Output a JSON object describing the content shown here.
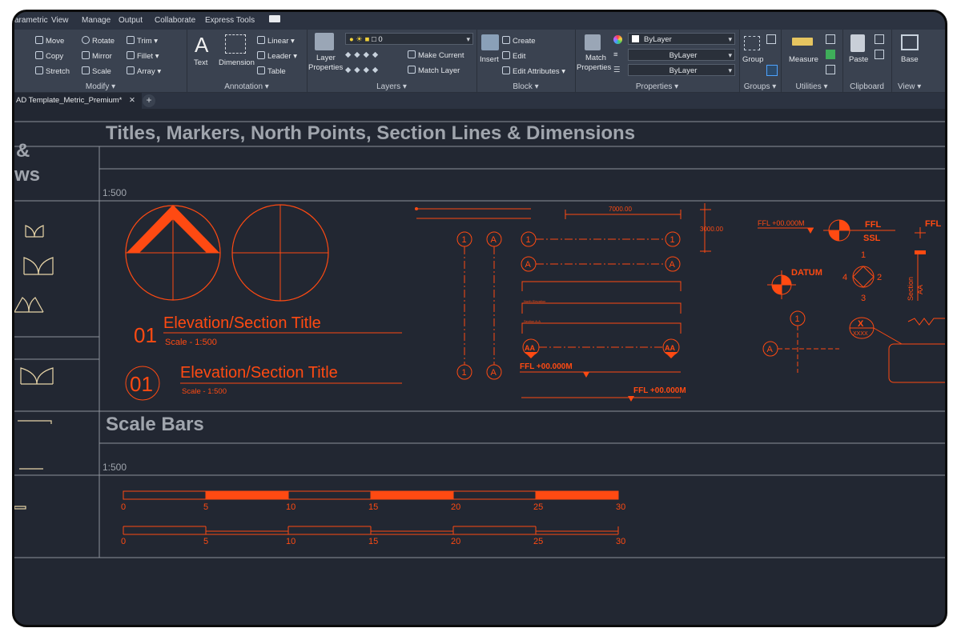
{
  "menu": {
    "items": [
      "arametric",
      "View",
      "Manage",
      "Output",
      "Collaborate",
      "Express Tools"
    ]
  },
  "ribbon": {
    "modify": {
      "title": "Modify ▾",
      "move": "Move",
      "rotate": "Rotate",
      "trim": "Trim",
      "copy": "Copy",
      "mirror": "Mirror",
      "fillet": "Fillet",
      "stretch": "Stretch",
      "scale": "Scale",
      "array": "Array"
    },
    "annotation": {
      "title": "Annotation ▾",
      "text": "Text",
      "dimension": "Dimension",
      "linear": "Linear",
      "leader": "Leader",
      "table": "Table"
    },
    "layers": {
      "title": "Layers ▾",
      "layer_properties_1": "Layer",
      "layer_properties_2": "Properties",
      "current_layer": "0",
      "make_current": "Make Current",
      "match_layer": "Match Layer"
    },
    "block": {
      "title": "Block ▾",
      "insert": "Insert",
      "create": "Create",
      "edit": "Edit",
      "edit_attributes": "Edit Attributes"
    },
    "properties": {
      "title": "Properties ▾",
      "match_1": "Match",
      "match_2": "Properties",
      "color": "ByLayer",
      "linetype": "ByLayer",
      "lineweight": "ByLayer"
    },
    "groups": {
      "title": "Groups ▾",
      "group": "Group"
    },
    "utilities": {
      "title": "Utilities ▾",
      "measure": "Measure"
    },
    "clipboard": {
      "title": "Clipboard",
      "paste": "Paste"
    },
    "view": {
      "title": "View ▾",
      "base": "Base"
    }
  },
  "tab": {
    "label": "AD Template_Metric_Premium*",
    "close": "✕",
    "new": "+"
  },
  "drawing": {
    "left_heading_1": "&",
    "left_heading_2": "ws",
    "section1_title": "Titles, Markers, North Points, Section Lines & Dimensions",
    "scale_1": "1:500",
    "title_block_1": {
      "number": "01",
      "title": "Elevation/Section Title",
      "scale": "Scale - 1:500"
    },
    "title_block_2": {
      "number": "01",
      "title": "Elevation/Section Title",
      "scale": "Scale - 1:500"
    },
    "dim_horizontal": "7000.00",
    "dim_vertical": "3000.00",
    "grid_1": "1",
    "grid_a": "A",
    "section_aa": "AA",
    "ffl_level": "FFL +00.000M",
    "ffl_small": "FFL +00.000M",
    "ffl": "FFL",
    "ssl": "SSL",
    "datum": "DATUM",
    "comp_1": "1",
    "comp_2": "2",
    "comp_3": "3",
    "comp_4": "4",
    "section_vertical_1": "Section",
    "section_vertical_2": "AA",
    "marker_x": "X",
    "marker_xxxx": "XXXX",
    "tiny_label_1": "North Elevation",
    "tiny_label_2": "Section A-A",
    "section2_title": "Scale Bars",
    "scale_2": "1:500",
    "scalebar_ticks": [
      "0",
      "5",
      "10",
      "15",
      "20",
      "25",
      "30"
    ]
  },
  "colors": {
    "accent": "#ff4a12",
    "panel_bg": "#222732",
    "line_grey": "#8c929b",
    "heading_grey": "#a0a5ad",
    "block_tan": "#e8d5a8"
  }
}
